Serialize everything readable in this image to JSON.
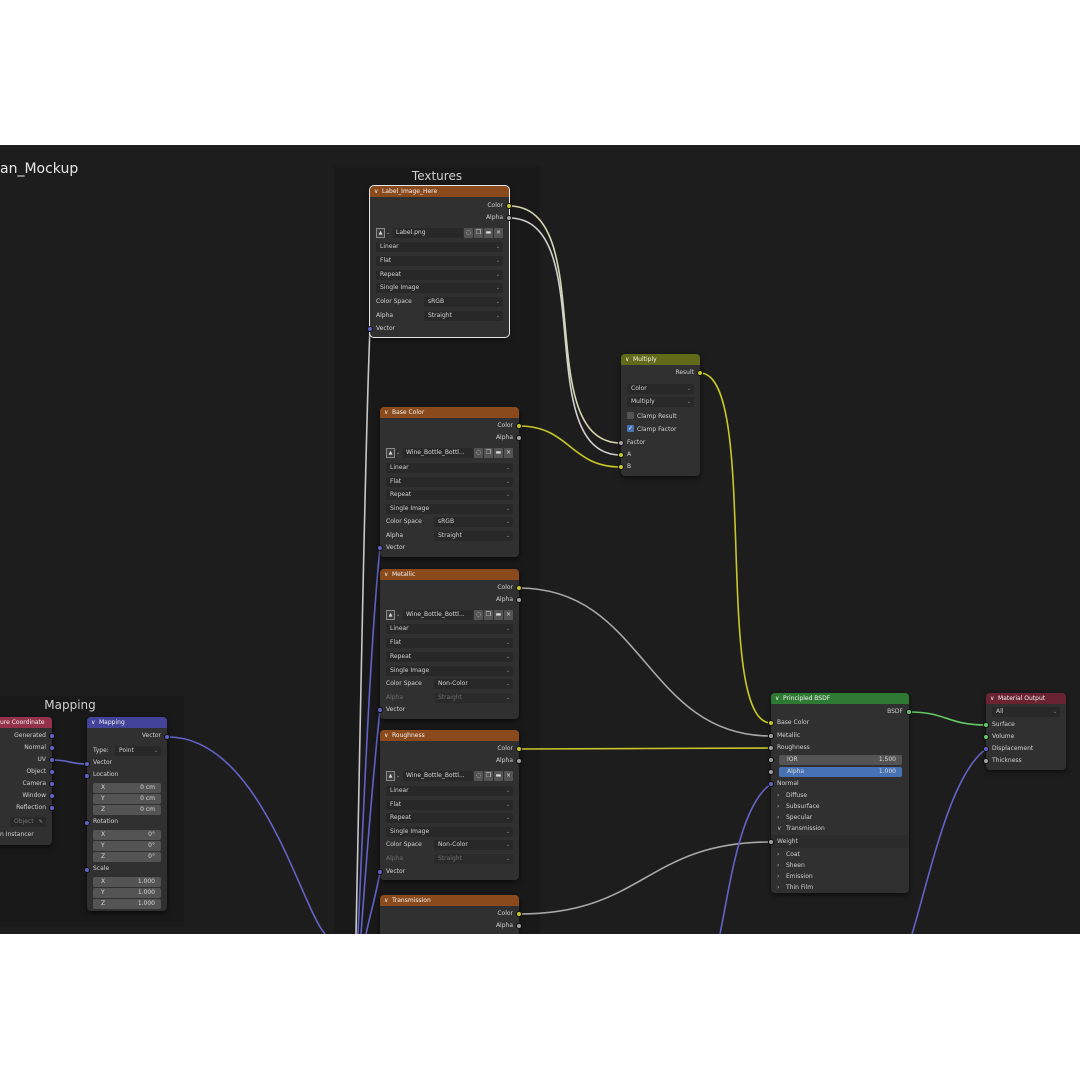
{
  "editor": {
    "title": "an_Mockup"
  },
  "frames": {
    "textures": "Textures",
    "mapping": "Mapping"
  },
  "texcoord": {
    "title": "ure Coordinate",
    "outputs": [
      "Generated",
      "Normal",
      "UV",
      "Object",
      "Camera",
      "Window",
      "Reflection"
    ],
    "object_placeholder": "Object",
    "instancer": "n Instancer"
  },
  "mapping": {
    "title": "Mapping",
    "out": "Vector",
    "type_label": "Type:",
    "type_value": "Point",
    "vector": "Vector",
    "location": "Location",
    "location_values": [
      {
        "k": "X",
        "v": "0 cm"
      },
      {
        "k": "Y",
        "v": "0 cm"
      },
      {
        "k": "Z",
        "v": "0 cm"
      }
    ],
    "rotation": "Rotation",
    "rotation_values": [
      {
        "k": "X",
        "v": "0°"
      },
      {
        "k": "Y",
        "v": "0°"
      },
      {
        "k": "Z",
        "v": "0°"
      }
    ],
    "scale": "Scale",
    "scale_values": [
      {
        "k": "X",
        "v": "1.000"
      },
      {
        "k": "Y",
        "v": "1.000"
      },
      {
        "k": "Z",
        "v": "1.000"
      }
    ]
  },
  "label_node": {
    "title": "Label_Image_Here",
    "out_color": "Color",
    "out_alpha": "Alpha",
    "image": "Label.png",
    "interpolation": "Linear",
    "projection": "Flat",
    "extension": "Repeat",
    "source": "Single Image",
    "colorspace_label": "Color Space",
    "colorspace": "sRGB",
    "alpha_label": "Alpha",
    "alpha": "Straight",
    "vector": "Vector"
  },
  "base_node": {
    "title": "Base Color",
    "out_color": "Color",
    "out_alpha": "Alpha",
    "image": "Wine_Bottle_Bottl...",
    "interpolation": "Linear",
    "projection": "Flat",
    "extension": "Repeat",
    "source": "Single Image",
    "colorspace_label": "Color Space",
    "colorspace": "sRGB",
    "alpha_label": "Alpha",
    "alpha": "Straight",
    "vector": "Vector"
  },
  "metal_node": {
    "title": "Metallic",
    "out_color": "Color",
    "out_alpha": "Alpha",
    "image": "Wine_Bottle_Bottl...",
    "interpolation": "Linear",
    "projection": "Flat",
    "extension": "Repeat",
    "source": "Single Image",
    "colorspace_label": "Color Space",
    "colorspace": "Non-Color",
    "alpha_label": "Alpha",
    "alpha": "Straight",
    "vector": "Vector"
  },
  "rough_node": {
    "title": "Roughness",
    "out_color": "Color",
    "out_alpha": "Alpha",
    "image": "Wine_Bottle_Bottl...",
    "interpolation": "Linear",
    "projection": "Flat",
    "extension": "Repeat",
    "source": "Single Image",
    "colorspace_label": "Color Space",
    "colorspace": "Non-Color",
    "alpha_label": "Alpha",
    "alpha": "Straight",
    "vector": "Vector"
  },
  "trans_node": {
    "title": "Transmission",
    "out_color": "Color",
    "out_alpha": "Alpha"
  },
  "multiply": {
    "title": "Multiply",
    "out": "Result",
    "type": "Color",
    "blend": "Multiply",
    "clamp_result": "Clamp Result",
    "clamp_factor": "Clamp Factor",
    "factor": "Factor",
    "a": "A",
    "b": "B"
  },
  "bsdf": {
    "title": "Principled BSDF",
    "out": "BSDF",
    "base_color": "Base Color",
    "metallic": "Metallic",
    "roughness": "Roughness",
    "ior_label": "IOR",
    "ior": "1.500",
    "alpha_label": "Alpha",
    "alpha": "1.000",
    "normal": "Normal",
    "panels": [
      "Diffuse",
      "Subsurface",
      "Specular"
    ],
    "transmission": "Transmission",
    "weight": "Weight",
    "panels2": [
      "Coat",
      "Sheen",
      "Emission",
      "Thin Film"
    ]
  },
  "output": {
    "title": "Material Output",
    "target": "All",
    "surface": "Surface",
    "volume": "Volume",
    "displacement": "Displacement",
    "thickness": "Thickness"
  },
  "colors": {
    "socket_color": "#c7c729",
    "socket_float": "#a1a1a1",
    "socket_vector": "#6363c7",
    "socket_shader": "#63c763",
    "header_texture": "#8a4a1c",
    "header_converter": "#616a18",
    "header_shader": "#2f7a33",
    "header_output": "#6a2330"
  }
}
